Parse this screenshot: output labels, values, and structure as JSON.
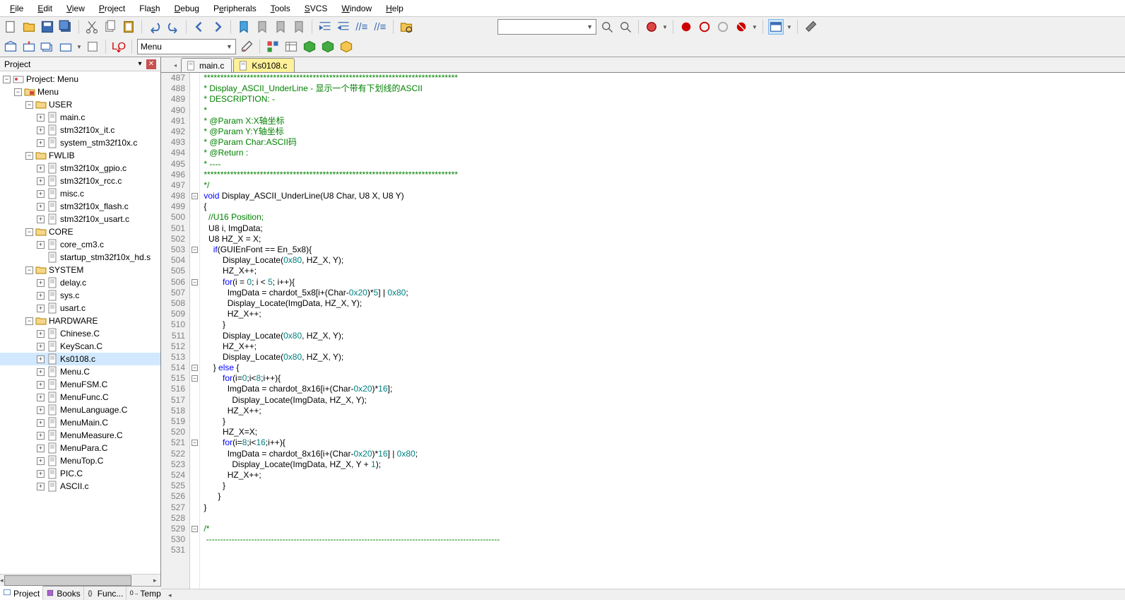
{
  "menu": {
    "items": [
      "File",
      "Edit",
      "View",
      "Project",
      "Flash",
      "Debug",
      "Peripherals",
      "Tools",
      "SVCS",
      "Window",
      "Help"
    ],
    "underline_idx": [
      0,
      0,
      0,
      0,
      3,
      0,
      1,
      0,
      0,
      0,
      0
    ]
  },
  "toolbar": {
    "combo1_value": "",
    "target_combo": "Menu"
  },
  "project_panel": {
    "title": "Project",
    "root": "Project: Menu",
    "tree": [
      {
        "depth": 0,
        "tw": "-",
        "icon": "target",
        "label": "Project: Menu"
      },
      {
        "depth": 1,
        "tw": "-",
        "icon": "folder-red",
        "label": "Menu"
      },
      {
        "depth": 2,
        "tw": "-",
        "icon": "folder",
        "label": "USER"
      },
      {
        "depth": 3,
        "tw": "+",
        "icon": "cfile",
        "label": "main.c"
      },
      {
        "depth": 3,
        "tw": "+",
        "icon": "cfile",
        "label": "stm32f10x_it.c"
      },
      {
        "depth": 3,
        "tw": "+",
        "icon": "cfile",
        "label": "system_stm32f10x.c"
      },
      {
        "depth": 2,
        "tw": "-",
        "icon": "folder",
        "label": "FWLIB"
      },
      {
        "depth": 3,
        "tw": "+",
        "icon": "cfile",
        "label": "stm32f10x_gpio.c"
      },
      {
        "depth": 3,
        "tw": "+",
        "icon": "cfile",
        "label": "stm32f10x_rcc.c"
      },
      {
        "depth": 3,
        "tw": "+",
        "icon": "cfile",
        "label": "misc.c"
      },
      {
        "depth": 3,
        "tw": "+",
        "icon": "cfile",
        "label": "stm32f10x_flash.c"
      },
      {
        "depth": 3,
        "tw": "+",
        "icon": "cfile",
        "label": "stm32f10x_usart.c"
      },
      {
        "depth": 2,
        "tw": "-",
        "icon": "folder",
        "label": "CORE"
      },
      {
        "depth": 3,
        "tw": "+",
        "icon": "cfile",
        "label": "core_cm3.c"
      },
      {
        "depth": 3,
        "tw": "",
        "icon": "sfile",
        "label": "startup_stm32f10x_hd.s"
      },
      {
        "depth": 2,
        "tw": "-",
        "icon": "folder",
        "label": "SYSTEM"
      },
      {
        "depth": 3,
        "tw": "+",
        "icon": "cfile",
        "label": "delay.c"
      },
      {
        "depth": 3,
        "tw": "+",
        "icon": "cfile",
        "label": "sys.c"
      },
      {
        "depth": 3,
        "tw": "+",
        "icon": "cfile",
        "label": "usart.c"
      },
      {
        "depth": 2,
        "tw": "-",
        "icon": "folder",
        "label": "HARDWARE"
      },
      {
        "depth": 3,
        "tw": "+",
        "icon": "cfile",
        "label": "Chinese.C"
      },
      {
        "depth": 3,
        "tw": "+",
        "icon": "cfile",
        "label": "KeyScan.C"
      },
      {
        "depth": 3,
        "tw": "+",
        "icon": "cfile",
        "label": "Ks0108.c",
        "selected": true
      },
      {
        "depth": 3,
        "tw": "+",
        "icon": "cfile",
        "label": "Menu.C"
      },
      {
        "depth": 3,
        "tw": "+",
        "icon": "cfile",
        "label": "MenuFSM.C"
      },
      {
        "depth": 3,
        "tw": "+",
        "icon": "cfile",
        "label": "MenuFunc.C"
      },
      {
        "depth": 3,
        "tw": "+",
        "icon": "cfile",
        "label": "MenuLanguage.C"
      },
      {
        "depth": 3,
        "tw": "+",
        "icon": "cfile",
        "label": "MenuMain.C"
      },
      {
        "depth": 3,
        "tw": "+",
        "icon": "cfile",
        "label": "MenuMeasure.C"
      },
      {
        "depth": 3,
        "tw": "+",
        "icon": "cfile",
        "label": "MenuPara.C"
      },
      {
        "depth": 3,
        "tw": "+",
        "icon": "cfile",
        "label": "MenuTop.C"
      },
      {
        "depth": 3,
        "tw": "+",
        "icon": "cfile",
        "label": "PIC.C"
      },
      {
        "depth": 3,
        "tw": "+",
        "icon": "cfile",
        "label": "ASCII.c"
      }
    ],
    "tabs": [
      "Project",
      "Books",
      "Func...",
      "Temp..."
    ]
  },
  "editor": {
    "tabs": [
      {
        "label": "main.c",
        "active": false
      },
      {
        "label": "Ks0108.c",
        "active": true
      }
    ],
    "first_line": 487,
    "fold_marks": {
      "498": "-",
      "503": "-",
      "506": "-",
      "514": "-",
      "515": "-",
      "521": "-",
      "529": "-"
    },
    "lines": [
      [
        [
          "com",
          " *****************************************************************************"
        ]
      ],
      [
        [
          "com",
          " * Display_ASCII_UnderLine - 显示一个带有下划线的ASCII"
        ]
      ],
      [
        [
          "com",
          " * DESCRIPTION: -"
        ]
      ],
      [
        [
          "com",
          " *"
        ]
      ],
      [
        [
          "com",
          " * @Param X:X轴坐标"
        ]
      ],
      [
        [
          "com",
          " * @Param Y:Y轴坐标"
        ]
      ],
      [
        [
          "com",
          " * @Param Char:ASCII码"
        ]
      ],
      [
        [
          "com",
          " * @Return :"
        ]
      ],
      [
        [
          "com",
          " * ----"
        ]
      ],
      [
        [
          "com",
          " *****************************************************************************"
        ]
      ],
      [
        [
          "com",
          " */"
        ]
      ],
      [
        [
          "txt",
          " "
        ],
        [
          "kw",
          "void"
        ],
        [
          "txt",
          " Display_ASCII_UnderLine(U8 Char, U8 X, U8 Y)"
        ]
      ],
      [
        [
          "txt",
          " {"
        ]
      ],
      [
        [
          "txt",
          "   "
        ],
        [
          "com",
          "//U16 Position;"
        ]
      ],
      [
        [
          "txt",
          "   U8 i, ImgData;"
        ]
      ],
      [
        [
          "txt",
          "   U8 HZ_X = X;"
        ]
      ],
      [
        [
          "txt",
          "     "
        ],
        [
          "kw",
          "if"
        ],
        [
          "txt",
          "(GUIEnFont == En_5x8){"
        ]
      ],
      [
        [
          "txt",
          "         Display_Locate("
        ],
        [
          "num",
          "0x80"
        ],
        [
          "txt",
          ", HZ_X, Y);"
        ]
      ],
      [
        [
          "txt",
          "         HZ_X++;"
        ]
      ],
      [
        [
          "txt",
          "         "
        ],
        [
          "kw",
          "for"
        ],
        [
          "txt",
          "(i = "
        ],
        [
          "num",
          "0"
        ],
        [
          "txt",
          "; i < "
        ],
        [
          "num",
          "5"
        ],
        [
          "txt",
          "; i++){"
        ]
      ],
      [
        [
          "txt",
          "           ImgData = chardot_5x8[i+(Char-"
        ],
        [
          "num",
          "0x20"
        ],
        [
          "txt",
          ")*"
        ],
        [
          "num",
          "5"
        ],
        [
          "txt",
          "] | "
        ],
        [
          "num",
          "0x80"
        ],
        [
          "txt",
          ";"
        ]
      ],
      [
        [
          "txt",
          "           Display_Locate(ImgData, HZ_X, Y);"
        ]
      ],
      [
        [
          "txt",
          "           HZ_X++;"
        ]
      ],
      [
        [
          "txt",
          "         }"
        ]
      ],
      [
        [
          "txt",
          "         Display_Locate("
        ],
        [
          "num",
          "0x80"
        ],
        [
          "txt",
          ", HZ_X, Y);"
        ]
      ],
      [
        [
          "txt",
          "         HZ_X++;"
        ]
      ],
      [
        [
          "txt",
          "         Display_Locate("
        ],
        [
          "num",
          "0x80"
        ],
        [
          "txt",
          ", HZ_X, Y);"
        ]
      ],
      [
        [
          "txt",
          "     } "
        ],
        [
          "kw",
          "else"
        ],
        [
          "txt",
          " {"
        ]
      ],
      [
        [
          "txt",
          "         "
        ],
        [
          "kw",
          "for"
        ],
        [
          "txt",
          "(i="
        ],
        [
          "num",
          "0"
        ],
        [
          "txt",
          ";i<"
        ],
        [
          "num",
          "8"
        ],
        [
          "txt",
          ";i++){"
        ]
      ],
      [
        [
          "txt",
          "           ImgData = chardot_8x16[i+(Char-"
        ],
        [
          "num",
          "0x20"
        ],
        [
          "txt",
          ")*"
        ],
        [
          "num",
          "16"
        ],
        [
          "txt",
          "];"
        ]
      ],
      [
        [
          "txt",
          "             Display_Locate(ImgData, HZ_X, Y);"
        ]
      ],
      [
        [
          "txt",
          "           HZ_X++;"
        ]
      ],
      [
        [
          "txt",
          "         }"
        ]
      ],
      [
        [
          "txt",
          "         HZ_X=X;"
        ]
      ],
      [
        [
          "txt",
          "         "
        ],
        [
          "kw",
          "for"
        ],
        [
          "txt",
          "(i="
        ],
        [
          "num",
          "8"
        ],
        [
          "txt",
          ";i<"
        ],
        [
          "num",
          "16"
        ],
        [
          "txt",
          ";i++){"
        ]
      ],
      [
        [
          "txt",
          "           ImgData = chardot_8x16[i+(Char-"
        ],
        [
          "num",
          "0x20"
        ],
        [
          "txt",
          ")*"
        ],
        [
          "num",
          "16"
        ],
        [
          "txt",
          "] | "
        ],
        [
          "num",
          "0x80"
        ],
        [
          "txt",
          ";"
        ]
      ],
      [
        [
          "txt",
          "             Display_Locate(ImgData, HZ_X, Y + "
        ],
        [
          "num",
          "1"
        ],
        [
          "txt",
          ");"
        ]
      ],
      [
        [
          "txt",
          "           HZ_X++;"
        ]
      ],
      [
        [
          "txt",
          "         }"
        ]
      ],
      [
        [
          "txt",
          "       }"
        ]
      ],
      [
        [
          "txt",
          " }"
        ]
      ],
      [
        [
          "txt",
          ""
        ]
      ],
      [
        [
          "com",
          " /*"
        ]
      ],
      [
        [
          "com",
          "  --------------------------------------------------------------------------------------------------------"
        ]
      ],
      [
        [
          "txt",
          ""
        ]
      ]
    ]
  }
}
